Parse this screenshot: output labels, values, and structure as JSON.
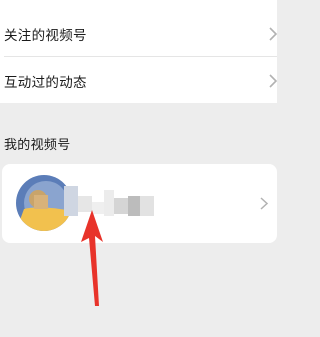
{
  "menu": {
    "items": [
      {
        "label": "关注的视频号"
      },
      {
        "label": "互动过的动态"
      }
    ]
  },
  "my_channel": {
    "section_title": "我的视频号"
  },
  "colors": {
    "page_background": "#ededed",
    "card_background": "#ffffff",
    "annotation_arrow": "#e8332a"
  },
  "icons": [
    "chevron-right-icon",
    "avatar",
    "pointer-arrow"
  ]
}
